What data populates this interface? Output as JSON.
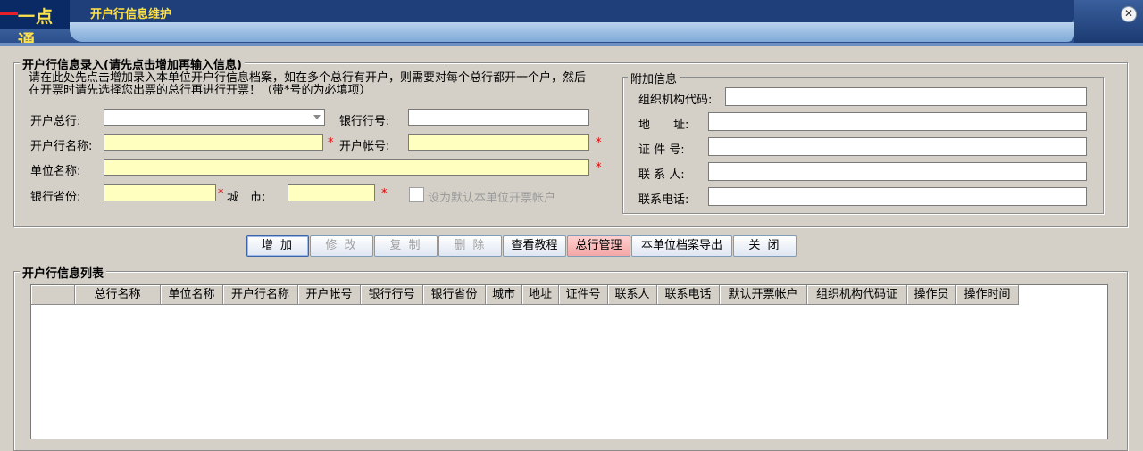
{
  "window": {
    "logo": "一点通",
    "title": "开户行信息维护",
    "close_glyph": "✕"
  },
  "entry_group": {
    "legend": "开户行信息录入(请先点击增加再输入信息)",
    "note": "请在此处先点击增加录入本单位开户行信息档案，如在多个总行有开户，则需要对每个总行都开一个户，然后在开票时请先选择您出票的总行再进行开票！（带*号的为必填项）",
    "fields": {
      "head_bank_label": "开户总行:",
      "bank_code_label": "银行行号:",
      "bank_name_label": "开户行名称:",
      "account_no_label": "开户帐号:",
      "unit_name_label": "单位名称:",
      "province_label": "银行省份:",
      "city_label": "城　市:",
      "default_checkbox_label": "设为默认本单位开票帐户"
    },
    "required_mark": "*"
  },
  "extra_group": {
    "legend": "附加信息",
    "fields": {
      "org_code_label": "组织机构代码:",
      "address_label": "地　　址:",
      "id_no_label": "证 件 号:",
      "contact_label": "联 系 人:",
      "phone_label": "联系电话:"
    }
  },
  "buttons": {
    "add": "增 加",
    "edit": "修 改",
    "copy": "复 制",
    "delete": "删 除",
    "tutorial": "查看教程",
    "head_bank_mgmt": "总行管理",
    "export": "本单位档案导出",
    "close": "关 闭"
  },
  "list_group": {
    "legend": "开户行信息列表",
    "columns": [
      "",
      "总行名称",
      "单位名称",
      "开户行名称",
      "开户帐号",
      "银行行号",
      "银行省份",
      "城市",
      "地址",
      "证件号",
      "联系人",
      "联系电话",
      "默认开票帐户",
      "组织机构代码证",
      "操作员",
      "操作时间"
    ]
  }
}
